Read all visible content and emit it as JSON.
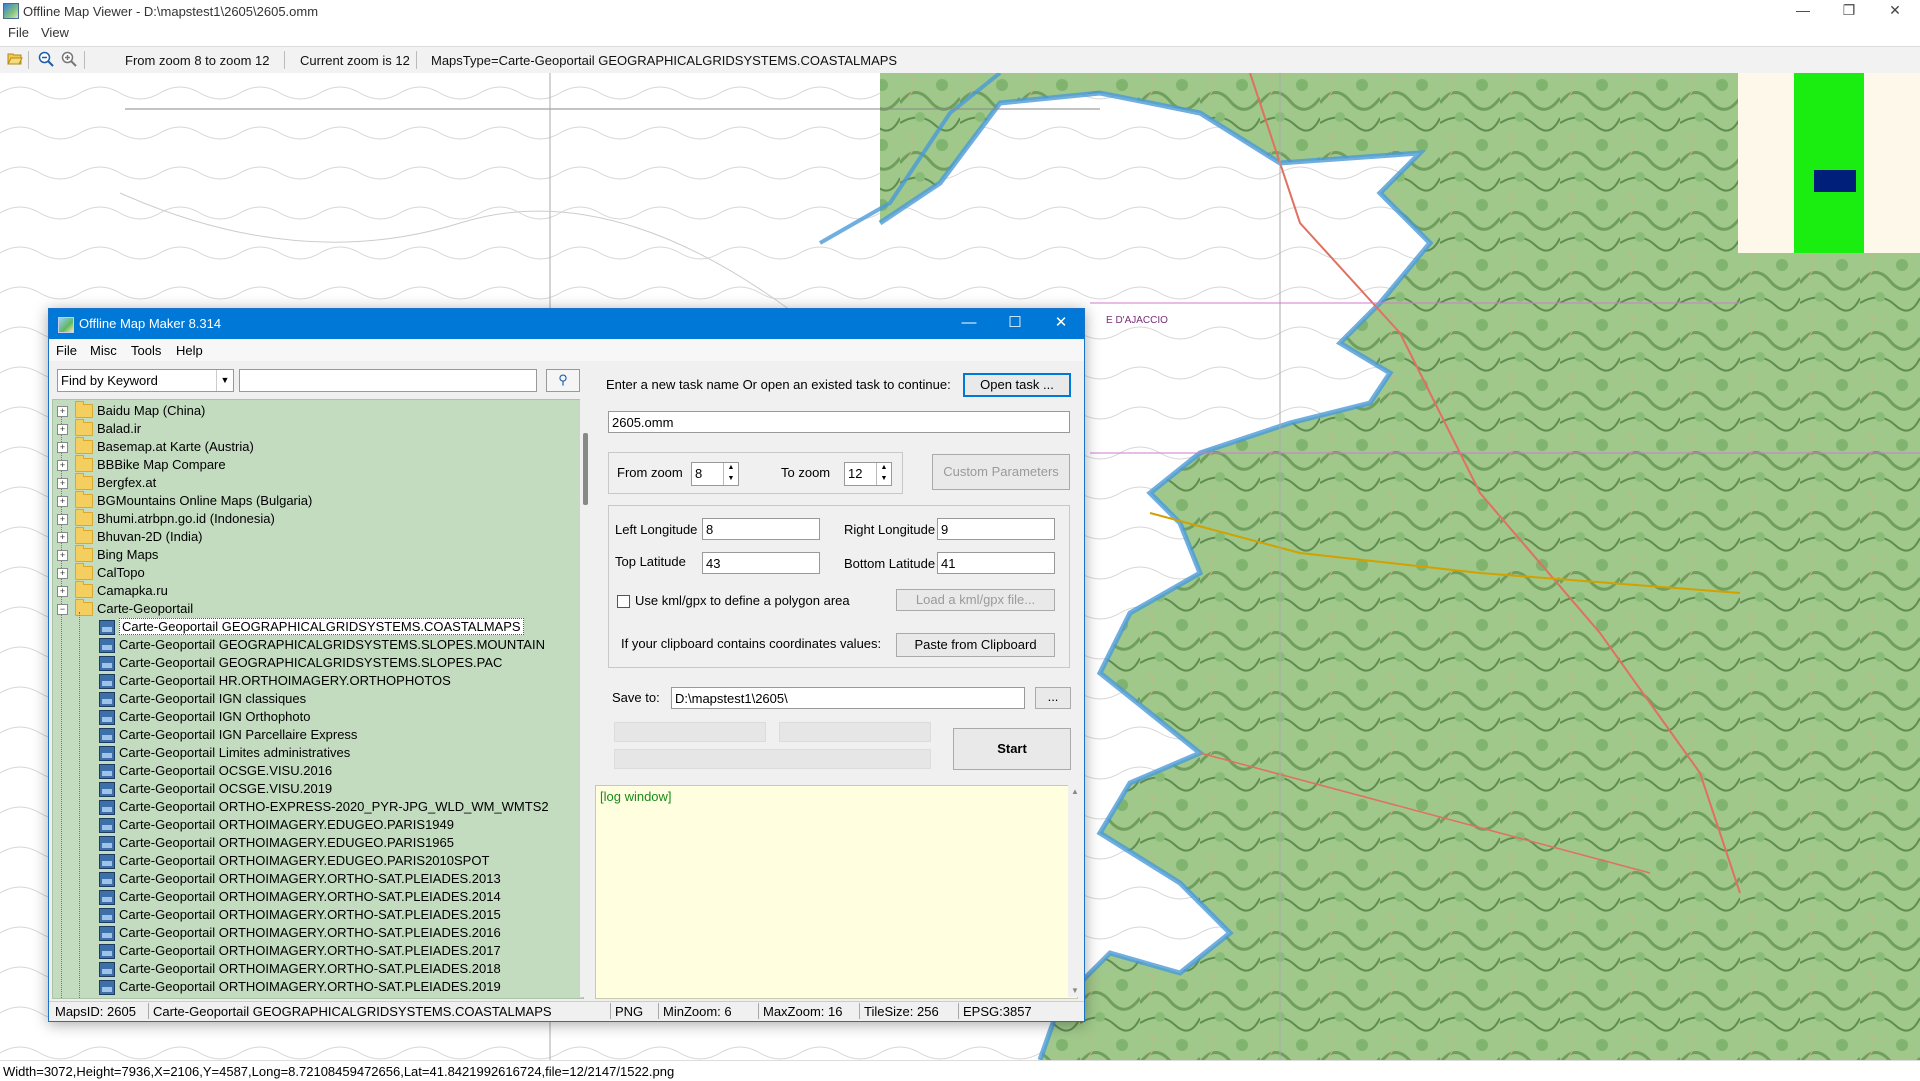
{
  "viewer": {
    "title": "Offline Map Viewer - D:\\mapstest1\\2605\\2605.omm",
    "menu": [
      "File",
      "View"
    ],
    "toolbar": {
      "zoom_range": "From zoom 8 to zoom 12",
      "current_zoom": "Current zoom is 12",
      "maps_type": "MapsType=Carte-Geoportail GEOGRAPHICALGRIDSYSTEMS.COASTALMAPS"
    },
    "status": "Width=3072,Height=7936,X=2106,Y=4587,Long=8.72108459472656,Lat=41.8421992616724,file=12/2147/1522.png",
    "map_labels": [
      "E D'AJACCIO"
    ],
    "overview_colors": {
      "background": "#fdf8ea",
      "coverage": "#19ee10",
      "viewport": "#001f7a"
    }
  },
  "dialog": {
    "title": "Offline Map Maker 8.314",
    "menu": [
      "File",
      "Misc",
      "Tools",
      "Help"
    ],
    "find_by": "Find by Keyword",
    "search_value": "",
    "tree": {
      "folders": [
        "Baidu Map (China)",
        "Balad.ir",
        "Basemap.at Karte (Austria)",
        "BBBike Map Compare",
        "Bergfex.at",
        "BGMountains Online Maps (Bulgaria)",
        "Bhumi.atrbpn.go.id (Indonesia)",
        "Bhuvan-2D (India)",
        "Bing Maps",
        "CalTopo",
        "Camapka.ru"
      ],
      "open_folder": "Carte-Geoportail",
      "children": [
        "Carte-Geoportail GEOGRAPHICALGRIDSYSTEMS.COASTALMAPS",
        "Carte-Geoportail GEOGRAPHICALGRIDSYSTEMS.SLOPES.MOUNTAIN",
        "Carte-Geoportail GEOGRAPHICALGRIDSYSTEMS.SLOPES.PAC",
        "Carte-Geoportail HR.ORTHOIMAGERY.ORTHOPHOTOS",
        "Carte-Geoportail IGN classiques",
        "Carte-Geoportail IGN Orthophoto",
        "Carte-Geoportail IGN Parcellaire Express",
        "Carte-Geoportail Limites administratives",
        "Carte-Geoportail OCSGE.VISU.2016",
        "Carte-Geoportail OCSGE.VISU.2019",
        "Carte-Geoportail ORTHO-EXPRESS-2020_PYR-JPG_WLD_WM_WMTS2",
        "Carte-Geoportail ORTHOIMAGERY.EDUGEO.PARIS1949",
        "Carte-Geoportail ORTHOIMAGERY.EDUGEO.PARIS1965",
        "Carte-Geoportail ORTHOIMAGERY.EDUGEO.PARIS2010SPOT",
        "Carte-Geoportail ORTHOIMAGERY.ORTHO-SAT.PLEIADES.2013",
        "Carte-Geoportail ORTHOIMAGERY.ORTHO-SAT.PLEIADES.2014",
        "Carte-Geoportail ORTHOIMAGERY.ORTHO-SAT.PLEIADES.2015",
        "Carte-Geoportail ORTHOIMAGERY.ORTHO-SAT.PLEIADES.2016",
        "Carte-Geoportail ORTHOIMAGERY.ORTHO-SAT.PLEIADES.2017",
        "Carte-Geoportail ORTHOIMAGERY.ORTHO-SAT.PLEIADES.2018",
        "Carte-Geoportail ORTHOIMAGERY.ORTHO-SAT.PLEIADES.2019"
      ],
      "selected": "Carte-Geoportail GEOGRAPHICALGRIDSYSTEMS.COASTALMAPS",
      "background": "#c3dcc0"
    },
    "task_prompt": "Enter a new task name Or open an existed task to continue:",
    "open_task": "Open task ...",
    "task_name": "2605.omm",
    "from_zoom_label": "From zoom",
    "from_zoom": "8",
    "to_zoom_label": "To zoom",
    "to_zoom": "12",
    "custom_params": "Custom Parameters",
    "left_lon_label": "Left Longitude",
    "left_lon": "8",
    "right_lon_label": "Right Longitude",
    "right_lon": "9",
    "top_lat_label": "Top Latitude",
    "top_lat": "43",
    "bottom_lat_label": "Bottom Latitude",
    "bottom_lat": "41",
    "kml_label": "Use kml/gpx to define a polygon area",
    "kml_checked": false,
    "load_kml": "Load a kml/gpx file...",
    "clipboard_label": "If your clipboard contains coordinates values:",
    "paste_clipboard": "Paste from Clipboard",
    "save_to_label": "Save to:",
    "save_to": "D:\\mapstest1\\2605\\",
    "browse": "...",
    "start": "Start",
    "log": "[log window]",
    "status": {
      "maps_id": "MapsID: 2605",
      "map_name": "Carte-Geoportail GEOGRAPHICALGRIDSYSTEMS.COASTALMAPS",
      "format": "PNG",
      "min_zoom": "MinZoom: 6",
      "max_zoom": "MaxZoom: 16",
      "tile_size": "TileSize: 256",
      "epsg": "EPSG:3857"
    }
  }
}
